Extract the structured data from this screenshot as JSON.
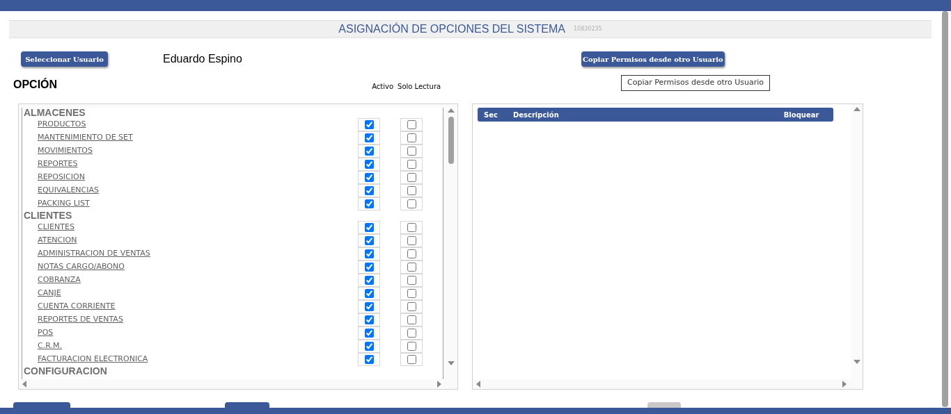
{
  "header": {
    "title": "ASIGNACIÓN DE OPCIONES DEL SISTEMA",
    "code": "10830235"
  },
  "user": {
    "button": "Seleccionar Usuario",
    "name": "Eduardo Espino"
  },
  "copy": {
    "button": "Copiar Permisos desde otro Usuario",
    "tooltip": "Copiar Permisos desde otro Usuario"
  },
  "options": {
    "title": "OPCIÓN",
    "columns": [
      "Activo",
      "Solo Lectura"
    ],
    "groups": [
      {
        "name": "ALMACENES",
        "children": [
          {
            "label": "PRODUCTOS",
            "active": true,
            "read_only": false
          },
          {
            "label": "MANTENIMIENTO DE SET",
            "active": true,
            "read_only": false
          },
          {
            "label": "MOVIMIENTOS",
            "active": true,
            "read_only": false
          },
          {
            "label": "REPORTES",
            "active": true,
            "read_only": false
          },
          {
            "label": "REPOSICION",
            "active": true,
            "read_only": false
          },
          {
            "label": "EQUIVALENCIAS",
            "active": true,
            "read_only": false
          },
          {
            "label": "PACKING LIST",
            "active": true,
            "read_only": false
          }
        ]
      },
      {
        "name": "CLIENTES",
        "children": [
          {
            "label": "CLIENTES",
            "active": true,
            "read_only": false
          },
          {
            "label": "ATENCION",
            "active": true,
            "read_only": false
          },
          {
            "label": "ADMINISTRACION DE VENTAS",
            "active": true,
            "read_only": false
          },
          {
            "label": "NOTAS CARGO/ABONO",
            "active": true,
            "read_only": false
          },
          {
            "label": "COBRANZA",
            "active": true,
            "read_only": false
          },
          {
            "label": "CANJE",
            "active": true,
            "read_only": false
          },
          {
            "label": "CUENTA CORRIENTE",
            "active": true,
            "read_only": false
          },
          {
            "label": "REPORTES DE VENTAS",
            "active": true,
            "read_only": false
          },
          {
            "label": "POS",
            "active": true,
            "read_only": false
          },
          {
            "label": "C.R.M.",
            "active": true,
            "read_only": false
          },
          {
            "label": "FACTURACION ELECTRONICA",
            "active": true,
            "read_only": false
          }
        ]
      },
      {
        "name": "CONFIGURACION"
      }
    ]
  },
  "blocked_table": {
    "columns": [
      "Sec",
      "Descripción",
      "Bloquear"
    ]
  }
}
